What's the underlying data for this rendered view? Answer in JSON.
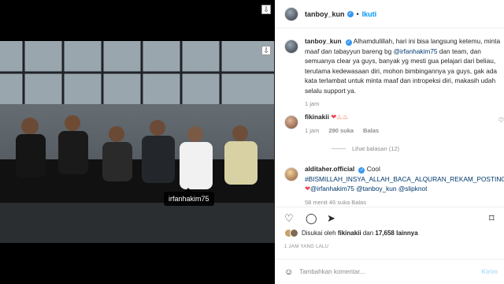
{
  "header": {
    "username": "tanboy_kun",
    "dot": "•",
    "follow_label": "Ikuti"
  },
  "photo": {
    "tag": "irfanhakim75"
  },
  "caption": {
    "username": "tanboy_kun",
    "text_1": "Alhamdulillah, hari ini bisa langsung ketemu, minta maaf dan tabayyun bareng bg ",
    "mention": "@irfanhakim75",
    "text_2": " dan team, dan semuanya clear ya guys, banyak yg mesti gua pelajari dari beliau, terutama kedewasaan diri, mohon bimbingannya ya guys, gak ada kata terlambat untuk minta maaf dan intropeksi diri, makasih udah selalu support ya.",
    "time": "1 jam"
  },
  "comment_1": {
    "username": "fikinakii",
    "time": "1 jam",
    "likes": "290 suka",
    "reply_label": "Balas",
    "view_replies": "Lihat balasan (12)"
  },
  "comment_2": {
    "username": "alditaher.official",
    "text_1": "Cool ",
    "hashtag": "#BISMILLAH_INSYA_ALLAH_BACA_ALQURAN_REKAM_POSTING_JUGA",
    "mention_1": "@irfanhakim75",
    "mention_2": "@tanboy_kun",
    "mention_3": "@slipknot",
    "meta": "58 menit   46 suka   Balas"
  },
  "likes": {
    "prefix": "Disukai oleh ",
    "user": "fikinakii",
    "middle": " dan ",
    "count": "17,658 lainnya"
  },
  "post_time": "1 JAM YANG LALU",
  "comment_input": {
    "placeholder": "Tambahkan komentar..."
  },
  "post_button": "Kirim",
  "icons": {
    "heart": "heart-icon",
    "comment": "comment-icon",
    "share": "share-icon",
    "save": "bookmark-icon",
    "emoji": "emoji-icon"
  }
}
